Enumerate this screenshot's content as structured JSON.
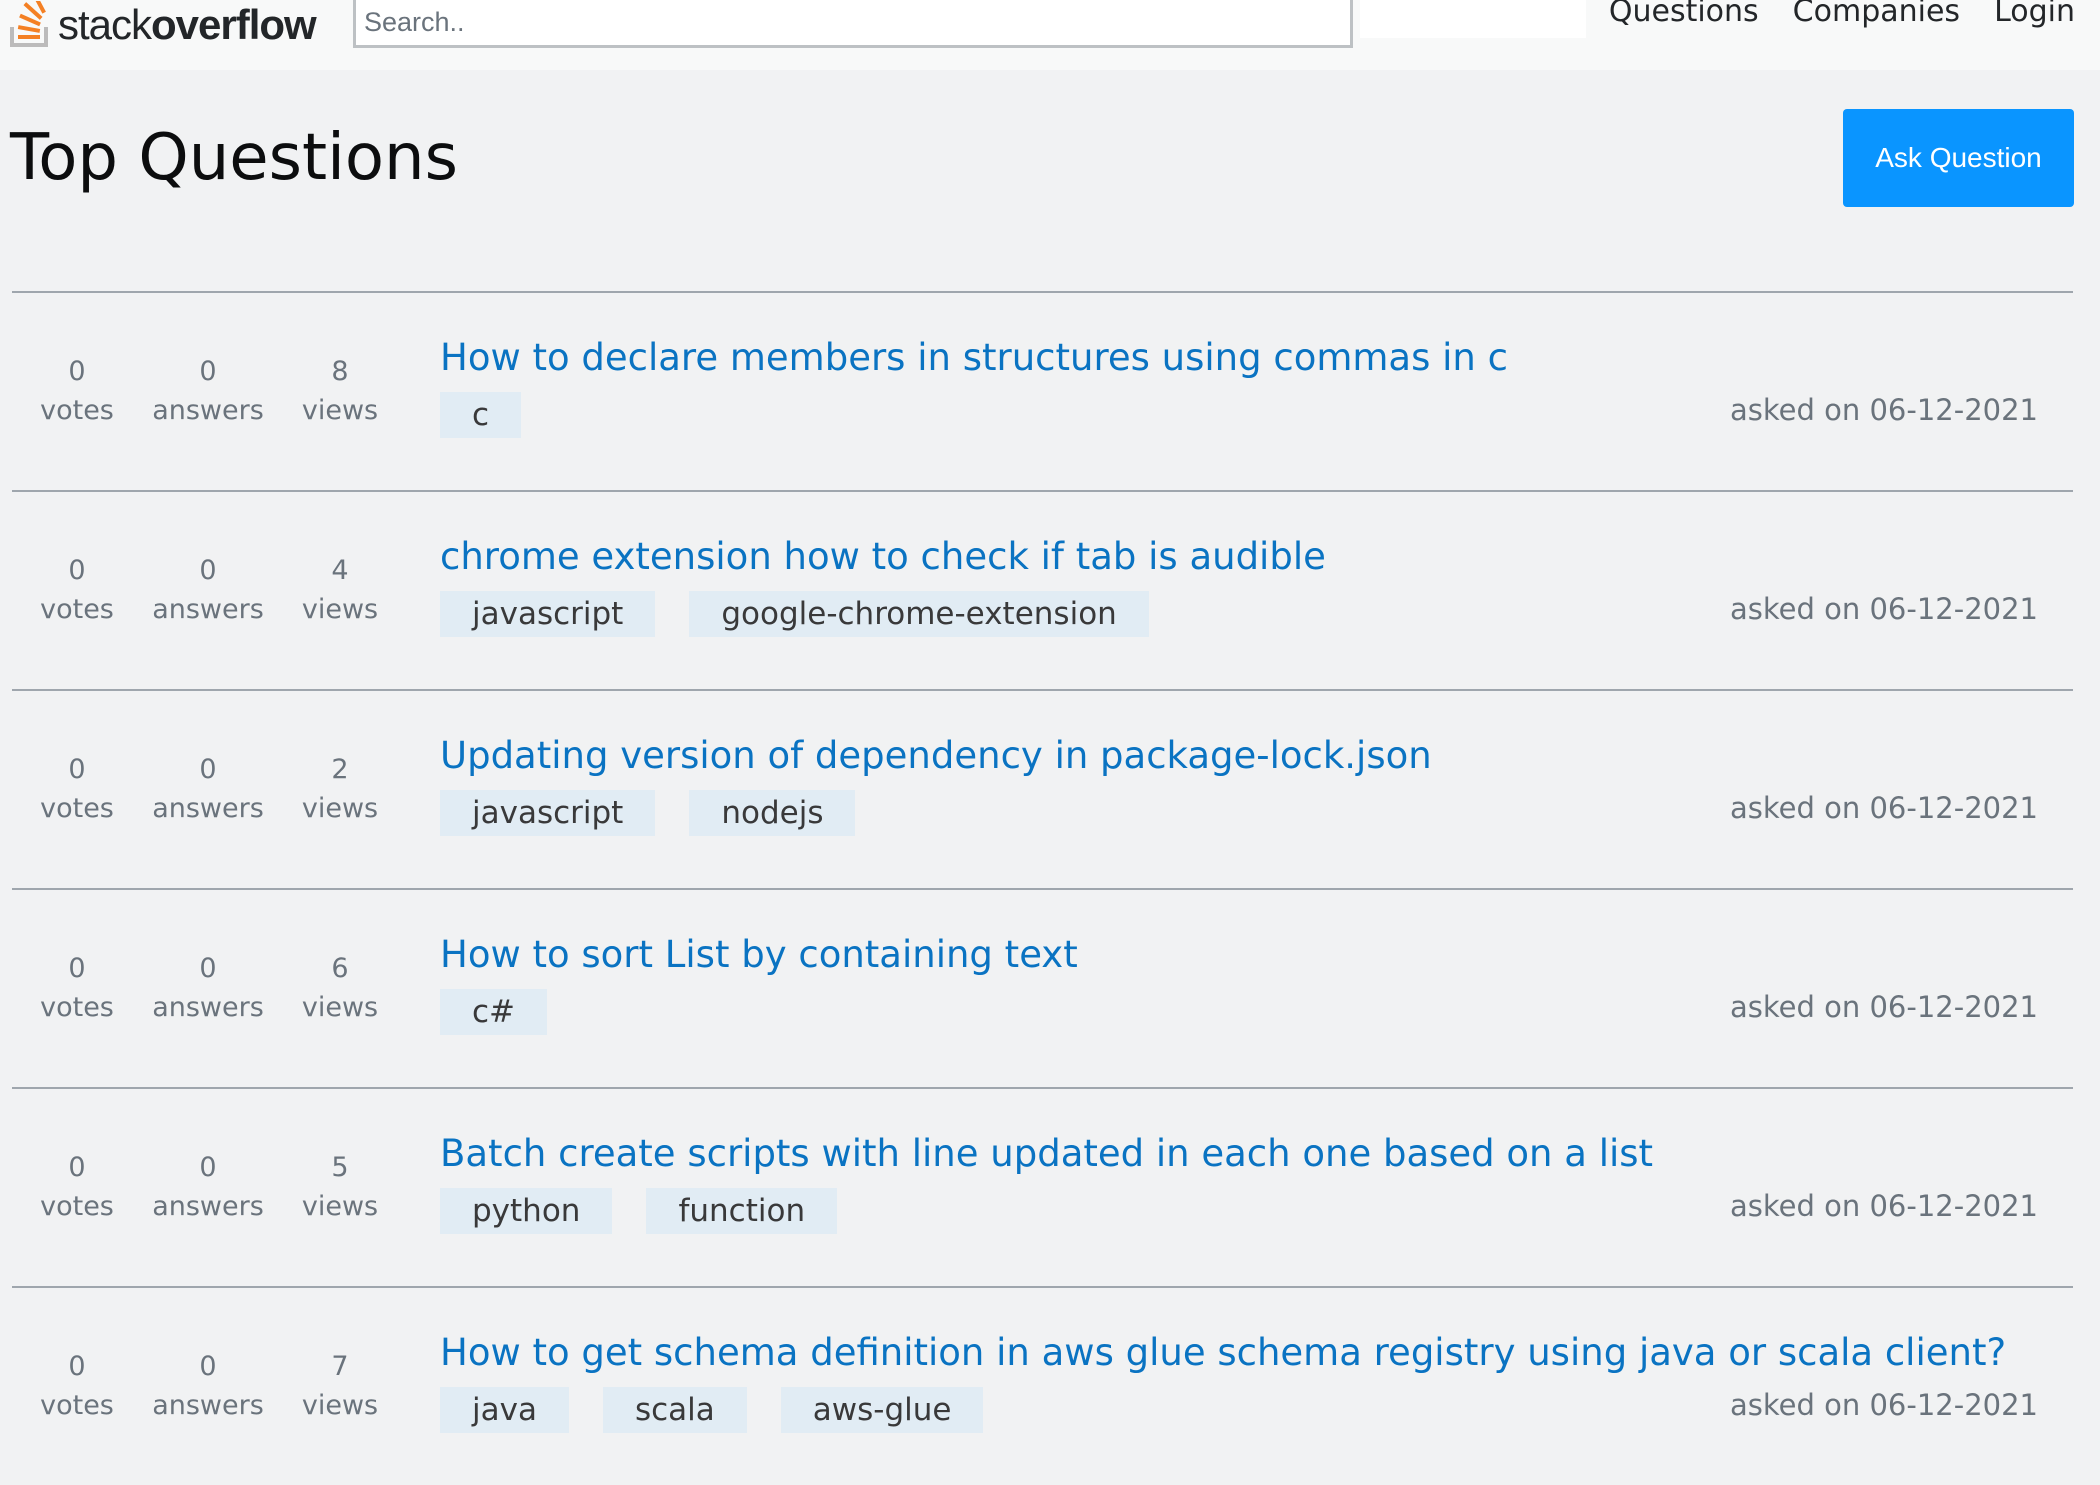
{
  "header": {
    "logo_light": "stack",
    "logo_bold": "overflow",
    "search_placeholder": "Search..",
    "nav": [
      {
        "label": "Questions"
      },
      {
        "label": "Companies"
      },
      {
        "label": "Login"
      }
    ]
  },
  "page": {
    "title": "Top Questions",
    "ask_button": "Ask Question"
  },
  "questions": [
    {
      "votes": "0",
      "votes_label": "votes",
      "answers": "0",
      "answers_label": "answers",
      "views": "8",
      "views_label": "views",
      "title": "How to declare members in structures using commas in c",
      "tags": [
        "c"
      ],
      "asked": "asked on 06-12-2021"
    },
    {
      "votes": "0",
      "votes_label": "votes",
      "answers": "0",
      "answers_label": "answers",
      "views": "4",
      "views_label": "views",
      "title": "chrome extension how to check if tab is audible",
      "tags": [
        "javascript",
        "google-chrome-extension"
      ],
      "asked": "asked on 06-12-2021"
    },
    {
      "votes": "0",
      "votes_label": "votes",
      "answers": "0",
      "answers_label": "answers",
      "views": "2",
      "views_label": "views",
      "title": "Updating version of dependency in package-lock.json",
      "tags": [
        "javascript",
        "nodejs"
      ],
      "asked": "asked on 06-12-2021"
    },
    {
      "votes": "0",
      "votes_label": "votes",
      "answers": "0",
      "answers_label": "answers",
      "views": "6",
      "views_label": "views",
      "title": "How to sort List by containing text",
      "tags": [
        "c#"
      ],
      "asked": "asked on 06-12-2021"
    },
    {
      "votes": "0",
      "votes_label": "votes",
      "answers": "0",
      "answers_label": "answers",
      "views": "5",
      "views_label": "views",
      "title": "Batch create scripts with line updated in each one based on a list",
      "tags": [
        "python",
        "function"
      ],
      "asked": "asked on 06-12-2021"
    },
    {
      "votes": "0",
      "votes_label": "votes",
      "answers": "0",
      "answers_label": "answers",
      "views": "7",
      "views_label": "views",
      "title": "How to get schema definition in aws glue schema registry using java or scala client?",
      "tags": [
        "java",
        "scala",
        "aws-glue"
      ],
      "asked": "asked on 06-12-2021"
    }
  ],
  "colors": {
    "accent": "#0a95ff",
    "link": "#0a73c2",
    "tag_bg": "#e1ecf4",
    "logo_orange": "#f48024",
    "logo_gray": "#bcbbbb"
  },
  "icons": {
    "logo": "stackoverflow-logo-icon"
  }
}
